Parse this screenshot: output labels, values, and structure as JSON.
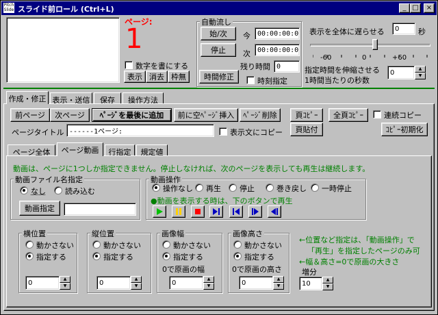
{
  "window": {
    "app_icon_text": "Pitch Slide",
    "title": "スライド前ロール (Ctrl+L)",
    "minimize": "_",
    "maximize": "□",
    "close": "×"
  },
  "top": {
    "page_label": "ページ:",
    "page_number": "1",
    "write_number_checkbox": "数字を書にする",
    "show_button": "表示",
    "erase_button": "消去",
    "frameless_button": "枠無"
  },
  "auto": {
    "group_title": "自動流し",
    "start_next_button": "始/次",
    "stop_button": "停止",
    "time_fix_button": "時間修正",
    "now_label": "今",
    "now_value": "00:00:00:000",
    "next_label": "次",
    "next_value": "00:00:00:000",
    "remaining_label": "残り時間",
    "remaining_value": "0",
    "time_specify_checkbox": "時刻指定",
    "delay_label": "表示を全体に遅らせる",
    "delay_value": "0",
    "delay_unit": "秒",
    "slider_ticks": [
      "-60",
      "0",
      "+60"
    ],
    "slider_position_percent": 54,
    "stretch_label_1": "指定時間を伸縮させる",
    "stretch_label_2": "1時間当たりの秒数",
    "stretch_value": "0"
  },
  "main_tabs": [
    "作成・修正",
    "表示・送信",
    "保存",
    "操作方法"
  ],
  "edit": {
    "prev_page_button": "前ページ",
    "next_page_button": "次ページ",
    "add_page_end_button": "ﾍﾟｰｼﾞを最後に追加",
    "insert_blank_button": "前に空ﾍﾟｰｼﾞ挿入",
    "delete_page_button": "ﾍﾟｰｼﾞ削除",
    "page_copy_button": "頁ｺﾋﾟｰ",
    "all_copy_button": "全頁ｺﾋﾟｰ",
    "continuous_copy_checkbox": "連続コピー",
    "page_paste_button": "頁貼付",
    "copy_init_button": "ｺﾋﾟｰ初期化",
    "page_title_label": "ページタイトル",
    "page_title_value": "------1ページ:",
    "copy_to_text_checkbox": "表示文にコピー"
  },
  "sub_tabs": [
    "ページ全体",
    "ページ動画",
    "行指定",
    "規定値"
  ],
  "video": {
    "note": "動画は、ページに1つしか指定できません。停止しなければ、次のページを表示しても再生は継続します。",
    "file_group_title": "動画ファイル名指定",
    "radio_none": "なし",
    "radio_load": "読み込む",
    "specify_button": "動画指定",
    "filename_value": "",
    "op_group_title": "動画操作",
    "op_options": [
      "操作なし",
      "再生",
      "停止",
      "巻き戻し",
      "一時停止"
    ],
    "op_selected": 0,
    "play_hint": "●動画を表示する時は、下のボタンで再生",
    "player_icons": [
      "play-icon",
      "pause-icon",
      "stop-icon",
      "skip-end-icon",
      "skip-start-icon",
      "step-forward-icon",
      "step-back-icon"
    ]
  },
  "position": {
    "groups": [
      {
        "title": "横位置",
        "opt1": "動かさない",
        "opt2": "指定する",
        "selected": 1,
        "note": "",
        "value": "0"
      },
      {
        "title": "縦位置",
        "opt1": "動かさない",
        "opt2": "指定する",
        "selected": 1,
        "note": "",
        "value": "0"
      },
      {
        "title": "画像幅",
        "opt1": "動かさない",
        "opt2": "指定する",
        "selected": 1,
        "note": "0で原画の幅",
        "value": "0"
      },
      {
        "title": "画像高さ",
        "opt1": "動かさない",
        "opt2": "指定する",
        "selected": 1,
        "note": "0で原画の高さ",
        "value": "0"
      }
    ],
    "hint_1": "←位置など指定は、「動画操作」で",
    "hint_2": "「再生」を指定したページのみ可",
    "hint_3": "←幅＆高さ=0で原画の大きさ",
    "increment_label": "増分",
    "increment_value": "10"
  },
  "colors": {
    "title_bar": "#000080",
    "accent_green": "#008000",
    "page_red": "#ff0000",
    "play_green": "#00c000",
    "pause_yellow": "#ffd000",
    "stop_red": "#ff0000",
    "media_blue": "#0000c0"
  }
}
